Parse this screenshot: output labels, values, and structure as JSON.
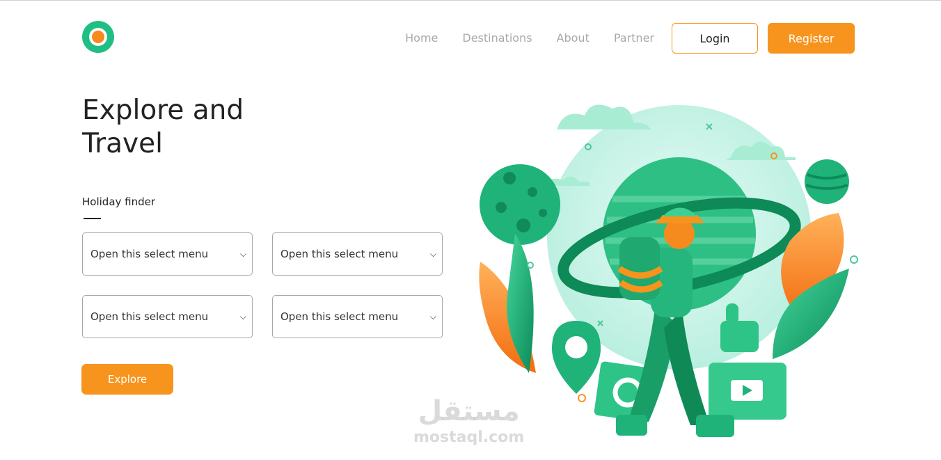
{
  "brand": {
    "logo_icon": "logo-ring-icon",
    "colors": {
      "green": "#1fbf83",
      "orange": "#f7941d"
    }
  },
  "nav": {
    "links": [
      "Home",
      "Destinations",
      "About",
      "Partner"
    ],
    "login_label": "Login",
    "register_label": "Register"
  },
  "hero": {
    "title_line1": "Explore and",
    "title_line2": "Travel",
    "finder_label": "Holiday finder",
    "selects": [
      "Open this select menu",
      "Open this select menu",
      "Open this select menu",
      "Open this select menu"
    ],
    "explore_label": "Explore"
  },
  "illustration": {
    "icon": "traveler-planet-illustration"
  },
  "watermark": {
    "arabic": "مستقل",
    "latin": "mostaql.com"
  }
}
